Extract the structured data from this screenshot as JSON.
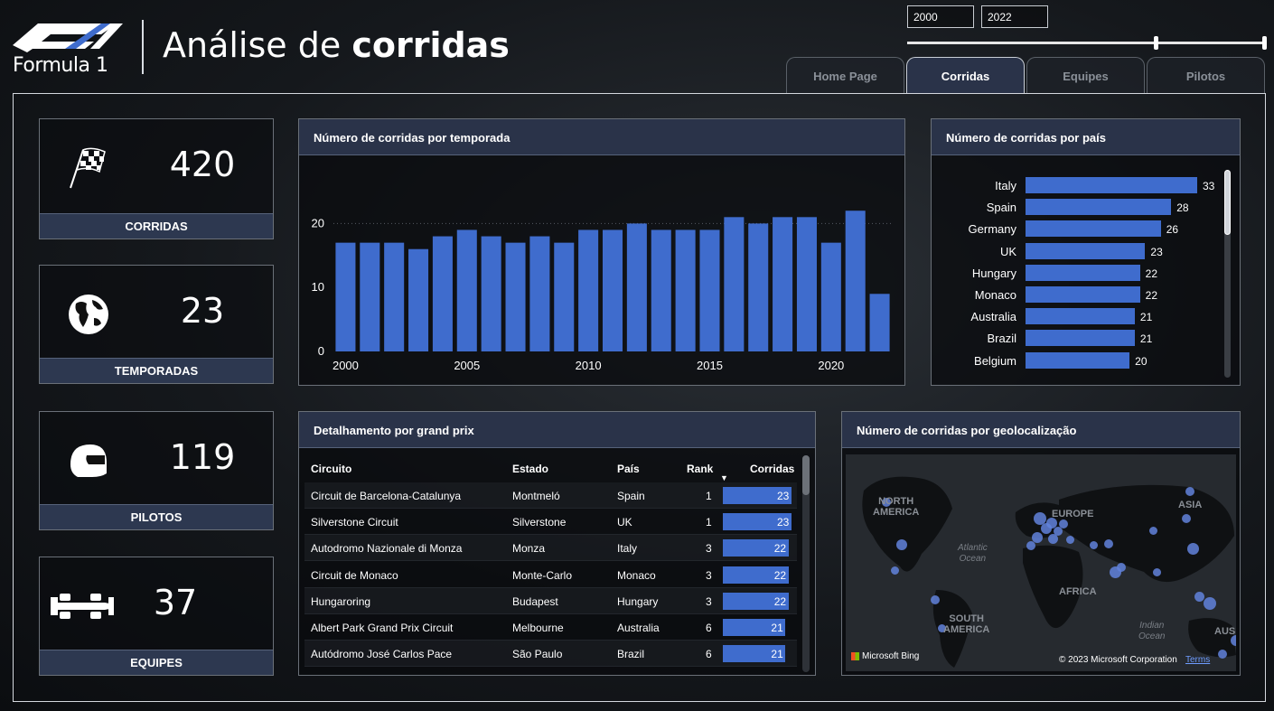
{
  "header": {
    "logo_text": "Formula 1",
    "title_light": "Análise de ",
    "title_bold": "corridas"
  },
  "year_filter": {
    "start": "2000",
    "end": "2022"
  },
  "tabs": [
    {
      "label": "Home Page",
      "active": false
    },
    {
      "label": "Corridas",
      "active": true
    },
    {
      "label": "Equipes",
      "active": false
    },
    {
      "label": "Pilotos",
      "active": false
    }
  ],
  "kpis": [
    {
      "value": "420",
      "label": "CORRIDAS",
      "icon": "checkered-flag-icon"
    },
    {
      "value": "23",
      "label": "TEMPORADAS",
      "icon": "globe-icon"
    },
    {
      "value": "119",
      "label": "PILOTOS",
      "icon": "helmet-icon"
    },
    {
      "value": "37",
      "label": "EQUIPES",
      "icon": "race-car-icon"
    }
  ],
  "season_chart": {
    "title": "Número de corridas por temporada",
    "x_ticks": [
      "2000",
      "2005",
      "2010",
      "2015",
      "2020"
    ],
    "y_ticks": [
      "0",
      "10",
      "20"
    ]
  },
  "country_chart": {
    "title": "Número de corridas por país"
  },
  "chart_data": [
    {
      "type": "bar",
      "title": "Número de corridas por temporada",
      "categories": [
        2000,
        2001,
        2002,
        2003,
        2004,
        2005,
        2006,
        2007,
        2008,
        2009,
        2010,
        2011,
        2012,
        2013,
        2014,
        2015,
        2016,
        2017,
        2018,
        2019,
        2020,
        2021,
        2022
      ],
      "values": [
        17,
        17,
        17,
        16,
        18,
        19,
        18,
        17,
        18,
        17,
        19,
        19,
        20,
        19,
        19,
        19,
        21,
        20,
        21,
        21,
        17,
        22,
        9
      ],
      "ylim": [
        0,
        25
      ],
      "color": "#3f6ccd"
    },
    {
      "type": "bar",
      "orientation": "horizontal",
      "title": "Número de corridas por país",
      "categories": [
        "Italy",
        "Spain",
        "Germany",
        "UK",
        "Hungary",
        "Monaco",
        "Australia",
        "Brazil",
        "Belgium"
      ],
      "values": [
        33,
        28,
        26,
        23,
        22,
        22,
        21,
        21,
        20
      ],
      "color": "#3f6ccd"
    }
  ],
  "table": {
    "title": "Detalhamento por grand prix",
    "columns": [
      "Circuito",
      "Estado",
      "País",
      "Rank",
      "Corridas"
    ],
    "rows": [
      [
        "Circuit de Barcelona-Catalunya",
        "Montmeló",
        "Spain",
        "1",
        "23"
      ],
      [
        "Silverstone Circuit",
        "Silverstone",
        "UK",
        "1",
        "23"
      ],
      [
        "Autodromo Nazionale di Monza",
        "Monza",
        "Italy",
        "3",
        "22"
      ],
      [
        "Circuit de Monaco",
        "Monte-Carlo",
        "Monaco",
        "3",
        "22"
      ],
      [
        "Hungaroring",
        "Budapest",
        "Hungary",
        "3",
        "22"
      ],
      [
        "Albert Park Grand Prix Circuit",
        "Melbourne",
        "Australia",
        "6",
        "21"
      ],
      [
        "Autódromo José Carlos Pace",
        "São Paulo",
        "Brazil",
        "6",
        "21"
      ]
    ],
    "max_corridas": 23
  },
  "map": {
    "title": "Número de corridas por geolocalização",
    "labels": [
      "NORTH\nAMERICA",
      "EUROPE",
      "ASIA",
      "AFRICA",
      "SOUTH\nAMERICA",
      "AUS"
    ],
    "oceans": [
      "Atlantic\nOcean",
      "Indian\nOcean"
    ],
    "provider": "Microsoft Bing",
    "copyright": "© 2023 Microsoft Corporation",
    "terms": "Terms"
  }
}
